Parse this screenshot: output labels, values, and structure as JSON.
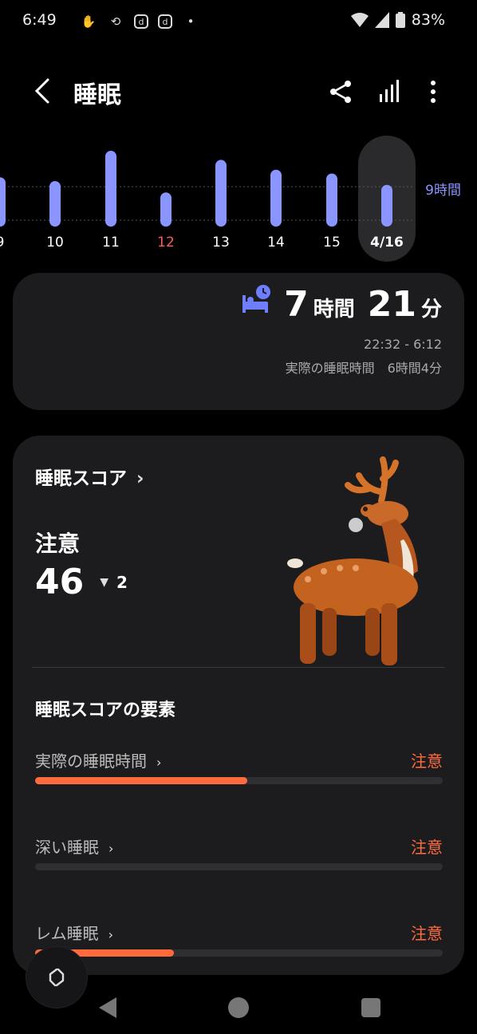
{
  "status": {
    "time": "6:49",
    "battery": "83%",
    "icons": [
      "hand-icon",
      "sync-off-icon",
      "d-icon",
      "d-icon",
      "dot-icon",
      "wifi-icon",
      "signal-icon",
      "battery-icon"
    ]
  },
  "appbar": {
    "title": "睡眠",
    "actions": [
      "share-icon",
      "chart-icon",
      "more-icon"
    ]
  },
  "chart": {
    "ref_label": "9時間",
    "days": [
      {
        "label": "9",
        "hours": 6.5,
        "color": "#ffffff"
      },
      {
        "label": "10",
        "hours": 6.0,
        "color": "#ffffff"
      },
      {
        "label": "11",
        "hours": 10.0,
        "color": "#ffffff"
      },
      {
        "label": "12",
        "hours": 4.5,
        "color": "#ff5a5a"
      },
      {
        "label": "13",
        "hours": 8.8,
        "color": "#ffffff"
      },
      {
        "label": "14",
        "hours": 7.5,
        "color": "#ffffff"
      },
      {
        "label": "15",
        "hours": 7.0,
        "color": "#ffffff"
      },
      {
        "label": "4/16",
        "hours": 5.5,
        "color": "#ffffff",
        "selected": true
      }
    ],
    "bar_color": "#8b95ff"
  },
  "duration": {
    "hours": "7",
    "hours_unit": "時間",
    "minutes": "21",
    "minutes_unit": "分",
    "range": "22:32 - 6:12",
    "actual": "実際の睡眠時間　6時間4分"
  },
  "score": {
    "title": "睡眠スコア",
    "state": "注意",
    "value": "46",
    "delta": "2",
    "factors_title": "睡眠スコアの要素",
    "factors": [
      {
        "label": "実際の睡眠時間",
        "status": "注意",
        "level": 0.52
      },
      {
        "label": "深い睡眠",
        "status": "注意",
        "level": 0.0
      },
      {
        "label": "レム睡眠",
        "status": "注意",
        "level": 0.34
      }
    ]
  },
  "colors": {
    "accent": "#8b95ff",
    "warning": "#ff6b3d",
    "card": "#1c1c1f"
  }
}
